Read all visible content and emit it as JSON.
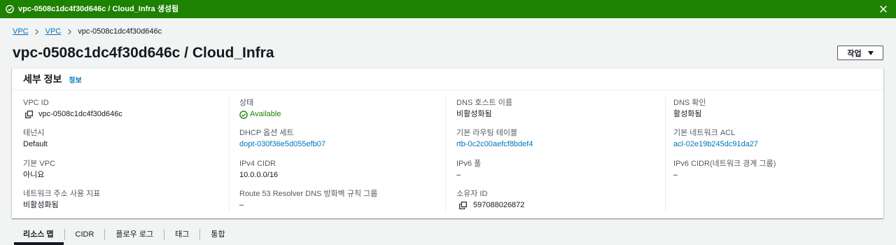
{
  "theme": {
    "success_color": "#1d8102",
    "link_color": "#0073bb",
    "text_color": "#16191f",
    "label_color": "#545b64",
    "page_bg": "#f2f3f3"
  },
  "banner": {
    "type": "success",
    "icon": "check-circle-icon",
    "message": "vpc-0508c1dc4f30d646c / Cloud_Infra 생성됨",
    "dismiss_icon": "close-icon"
  },
  "breadcrumb": {
    "separator_icon": "chevron-right-icon",
    "items": [
      {
        "label": "VPC",
        "link": true
      },
      {
        "label": "VPC",
        "link": true
      },
      {
        "label": "vpc-0508c1dc4f30d646c",
        "link": false
      }
    ]
  },
  "header": {
    "title": "vpc-0508c1dc4f30d646c / Cloud_Infra",
    "actions_button": {
      "label": "작업",
      "icon": "caret-down-icon"
    }
  },
  "details": {
    "title": "세부 정보",
    "info_link": "정보",
    "columns": [
      [
        {
          "label": "VPC ID",
          "value": "vpc-0508c1dc4f30d646c",
          "icon": "copy-icon"
        },
        {
          "label": "테넌시",
          "value": "Default"
        },
        {
          "label": "기본 VPC",
          "value": "아니요"
        },
        {
          "label": "네트워크 주소 사용 지표",
          "value": "비활성화됨"
        }
      ],
      [
        {
          "label": "상태",
          "value": "Available",
          "icon": "status-success-icon"
        },
        {
          "label": "DHCP 옵션 세트",
          "value": "dopt-030f36e5d055efb07",
          "link": true
        },
        {
          "label": "IPv4 CIDR",
          "value": "10.0.0.0/16"
        },
        {
          "label": "Route 53 Resolver DNS 방화벽 규칙 그룹",
          "value": "–"
        }
      ],
      [
        {
          "label": "DNS 호스트 이름",
          "value": "비활성화됨"
        },
        {
          "label": "기본 라우팅 테이블",
          "value": "rtb-0c2c00aefcf8bdef4",
          "link": true
        },
        {
          "label": "IPv6 풀",
          "value": "–"
        },
        {
          "label": "소유자 ID",
          "value": "597088026872",
          "icon": "copy-icon"
        }
      ],
      [
        {
          "label": "DNS 확인",
          "value": "활성화됨"
        },
        {
          "label": "기본 네트워크 ACL",
          "value": "acl-02e19b245dc91da27",
          "link": true
        },
        {
          "label": "IPv6 CIDR(네트워크 경계 그룹)",
          "value": "–"
        }
      ]
    ]
  },
  "tabs": [
    {
      "label": "리소스 맵",
      "active": true
    },
    {
      "label": "CIDR",
      "active": false
    },
    {
      "label": "플로우 로그",
      "active": false
    },
    {
      "label": "태그",
      "active": false
    },
    {
      "label": "통합",
      "active": false
    }
  ]
}
